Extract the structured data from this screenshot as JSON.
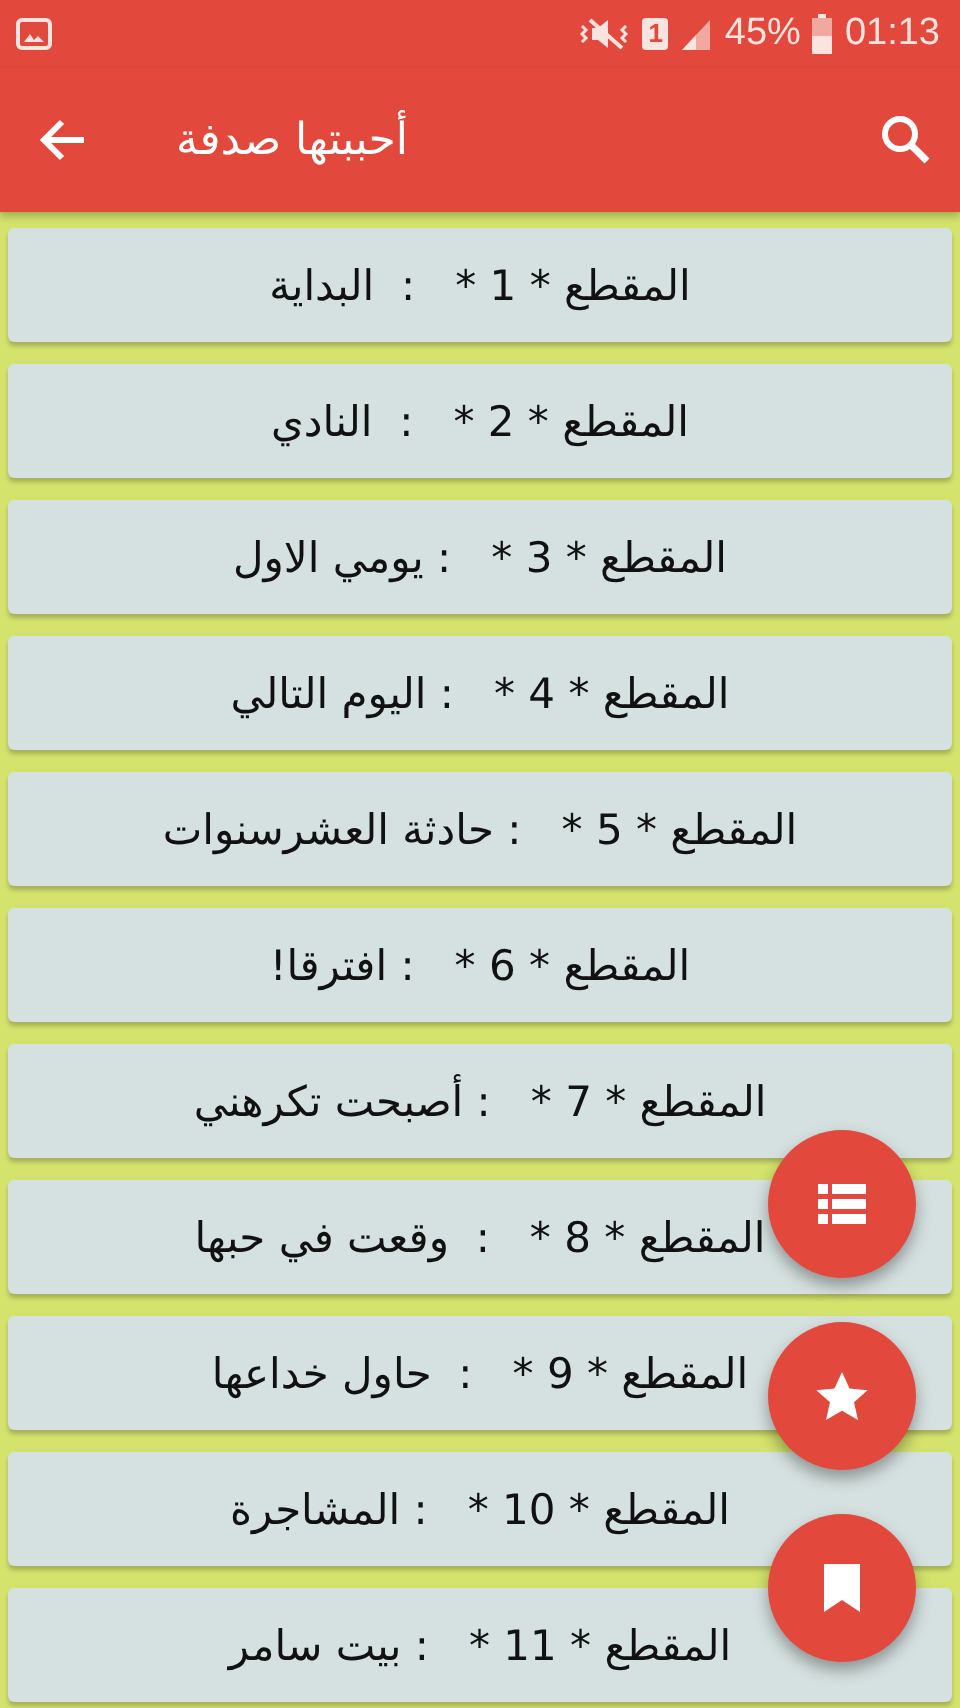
{
  "status_bar": {
    "sim_slot": "1",
    "battery": "45%",
    "time": "01:13"
  },
  "app_bar": {
    "title": "أحببتها صدفة"
  },
  "chapters": [
    {
      "label": "المقطع * 1 *   :  البداية"
    },
    {
      "label": "المقطع * 2 *   :  النادي"
    },
    {
      "label": "المقطع * 3 *   : يومي الاول"
    },
    {
      "label": "المقطع * 4 *   : اليوم التالي"
    },
    {
      "label": "المقطع * 5 *   : حادثة العشرسنوات"
    },
    {
      "label": "المقطع * 6 *   : افترقا!"
    },
    {
      "label": "المقطع * 7 *   : أصبحت تكرهني"
    },
    {
      "label": "المقطع * 8 *   :  وقعت في حبها"
    },
    {
      "label": "المقطع * 9 *   :  حاول خداعها"
    },
    {
      "label": "المقطع * 10 *   : المشاجرة"
    },
    {
      "label": "المقطع * 11 *   : بيت سامر"
    }
  ],
  "fabs": [
    {
      "kind": "list"
    },
    {
      "kind": "star"
    },
    {
      "kind": "bookmark"
    }
  ]
}
